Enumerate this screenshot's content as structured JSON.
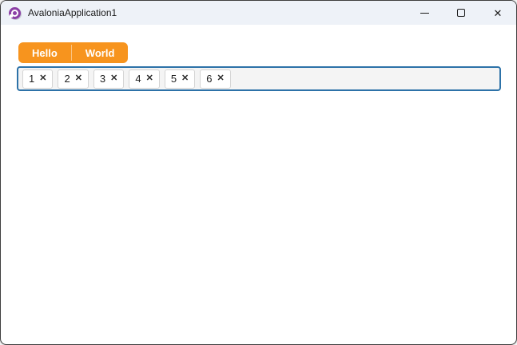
{
  "window": {
    "title": "AvaloniaApplication1",
    "logo": "avalonia-logo-icon",
    "controls": {
      "minimize": "minimize-icon",
      "maximize": "maximize-icon",
      "close": "close-icon",
      "close_glyph": "✕"
    }
  },
  "colors": {
    "titlebar_bg": "#EEF2F8",
    "accent_orange": "#F7941E",
    "focus_border_blue": "#2D72A8",
    "logo_purple": "#8B3FA6",
    "field_bg": "#F4F4F4"
  },
  "tab_strip": {
    "tabs": [
      {
        "label": "Hello"
      },
      {
        "label": "World"
      }
    ]
  },
  "chip_field": {
    "chips": [
      {
        "label": "1",
        "remove_glyph": "✕"
      },
      {
        "label": "2",
        "remove_glyph": "✕"
      },
      {
        "label": "3",
        "remove_glyph": "✕"
      },
      {
        "label": "4",
        "remove_glyph": "✕"
      },
      {
        "label": "5",
        "remove_glyph": "✕"
      },
      {
        "label": "6",
        "remove_glyph": "✕"
      }
    ]
  }
}
